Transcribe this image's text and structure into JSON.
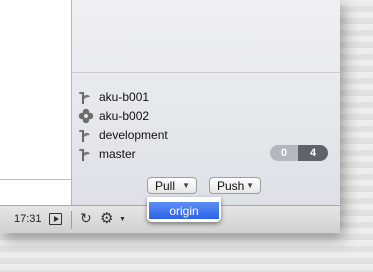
{
  "branches": [
    {
      "name": "aku-b001",
      "icon": "branch-icon"
    },
    {
      "name": "aku-b002",
      "icon": "flower-icon"
    },
    {
      "name": "development",
      "icon": "branch-icon"
    },
    {
      "name": "master",
      "icon": "branch-icon"
    }
  ],
  "master_badge": {
    "behind": "0",
    "ahead": "4"
  },
  "buttons": {
    "pull": "Pull",
    "push": "Push"
  },
  "pull_menu": {
    "items": [
      "origin"
    ]
  },
  "toolbar": {
    "time": "17:31"
  },
  "colors": {
    "menu_highlight": "#2c63e8",
    "badge_dark": "#5e6369",
    "badge_light": "#b3b8bf"
  }
}
